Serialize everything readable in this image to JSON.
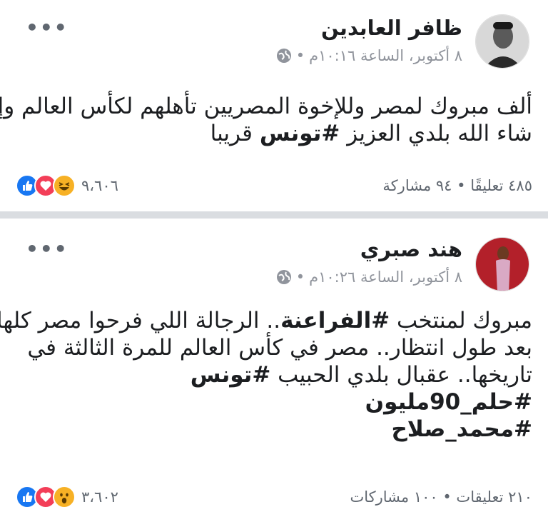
{
  "posts": [
    {
      "author": "ظافر العابدين",
      "timestamp": "٨ أكتوبر، الساعة ١٠:١٦م",
      "text_lines": [
        "ألف مبروك لمصر وللإخوة المصريين تأهلهم لكأس العالم وإن",
        "شاء الله بلدي العزيز"
      ],
      "hashtag_inline": "#تونس",
      "text_tail": "قريبا",
      "reactions": [
        "like",
        "love",
        "haha"
      ],
      "reaction_count": "٩،٦٠٦",
      "comments_shares": "٤٨٥ تعليقًا • ٩٤ مشاركة",
      "more": "•••"
    },
    {
      "author": "هند صبري",
      "timestamp": "٨ أكتوبر، الساعة ١٠:٢٦م",
      "line1_prefix": "مبروك لمنتخب",
      "line1_tag": "#الفراعنة",
      "line1_suffix": ".. الرجالة اللي فرحوا مصر كلها",
      "line2": "بعد طول انتظار.. مصر في كأس العالم للمرة الثالثة في",
      "line3_prefix": "تاريخها.. عقبال بلدي الحبيب",
      "line3_tag": "#تونس",
      "tag_line4": "#حلم_90مليون",
      "tag_line5": "#محمد_صلاح",
      "reactions": [
        "like",
        "love",
        "wow"
      ],
      "reaction_count": "٣،٦٠٢",
      "comments_shares": "٢١٠ تعليقات • ١٠٠ مشاركات",
      "more": "•••"
    }
  ],
  "separator": "•",
  "colors": {
    "like": "#1877f2",
    "love": "#f33e58",
    "haha": "#f7b125",
    "meta": "#90949c"
  }
}
